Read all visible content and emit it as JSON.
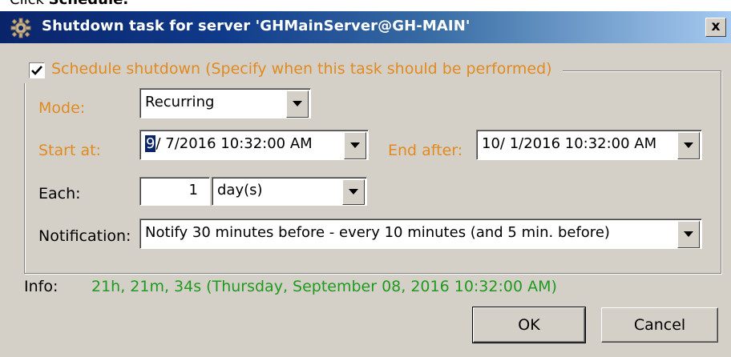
{
  "instruction": {
    "prefix": "Click ",
    "bold": "Schedule."
  },
  "window": {
    "title": "Shutdown task for server 'GHMainServer@GH-MAIN'",
    "close_glyph": "x"
  },
  "schedule": {
    "checked": true,
    "label": "Schedule shutdown (Specify when this task should be performed)"
  },
  "form": {
    "mode_label": "Mode:",
    "mode_value": "Recurring",
    "start_label": "Start at:",
    "start_value_selected": "9",
    "start_value_rest": "/ 7/2016 10:32:00 AM",
    "end_label": "End after:",
    "end_value": "10/ 1/2016 10:32:00 AM",
    "each_label": "Each:",
    "each_value": "1",
    "each_unit": "day(s)",
    "notification_label": "Notification:",
    "notification_value": "Notify 30 minutes before - every 10 minutes (and 5 min. before)"
  },
  "info": {
    "label": "Info:",
    "value": "21h, 21m, 34s (Thursday, September 08, 2016 10:32:00 AM)"
  },
  "buttons": {
    "ok": "OK",
    "cancel": "Cancel"
  },
  "colors": {
    "accent_label": "#e08a1f",
    "info_text": "#1e9a1e",
    "title_bar": "#0a246a"
  }
}
